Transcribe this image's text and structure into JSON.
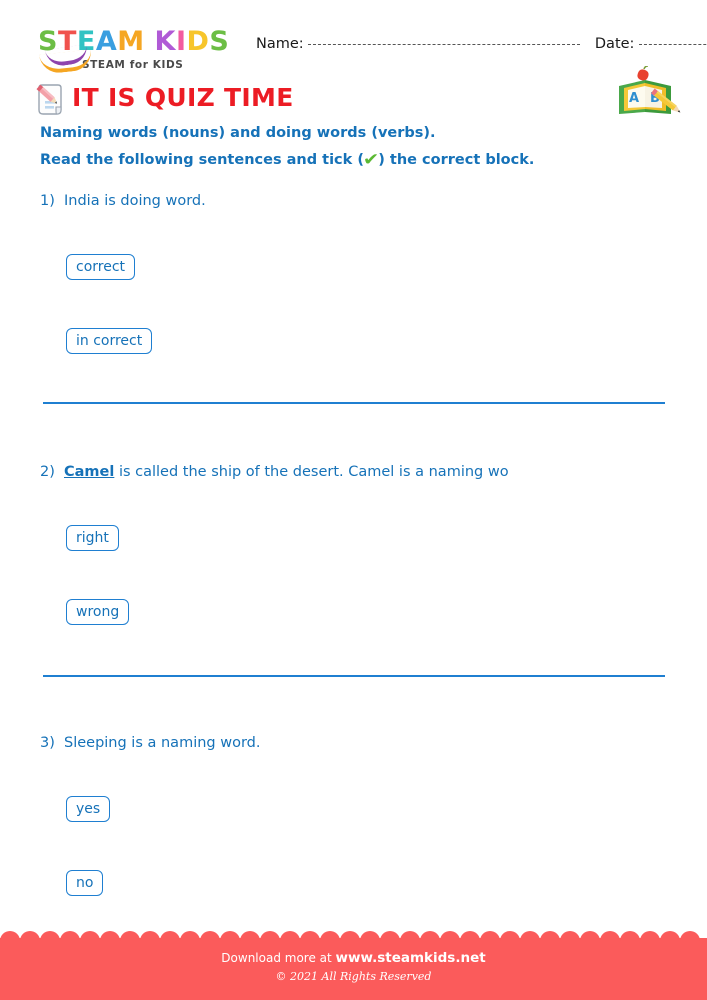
{
  "brand": {
    "logo_letters": [
      {
        "char": "S",
        "color": "#6cbe45"
      },
      {
        "char": "T",
        "color": "#f0524d"
      },
      {
        "char": "E",
        "color": "#31c3c3"
      },
      {
        "char": "A",
        "color": "#3a9fe0"
      },
      {
        "char": "M",
        "color": "#f5a623"
      },
      {
        "char": " ",
        "color": "#ffffff"
      },
      {
        "char": "K",
        "color": "#b05ad6"
      },
      {
        "char": "I",
        "color": "#f25ba0"
      },
      {
        "char": "D",
        "color": "#f7c52b"
      },
      {
        "char": "S",
        "color": "#6cbe45"
      }
    ],
    "tagline": "STEAM for KIDS",
    "swoosh_color_1": "#f5a623",
    "swoosh_color_2": "#8e44ad"
  },
  "header": {
    "name_label": "Name:",
    "date_label": "Date:"
  },
  "title": {
    "text": "IT IS QUIZ TIME",
    "color": "#ec1c24",
    "icon": "quiz-pencil-paper-icon"
  },
  "decor": {
    "abc_book_icon": "abc-book-icon",
    "abc_letters": [
      "A",
      "B"
    ]
  },
  "instructions": {
    "line1": "Naming words (nouns) and doing words (verbs).",
    "line2_before": "Read the following sentences and tick (",
    "tick_glyph": "✔",
    "line2_after": ") the correct block.",
    "color": "#1672b8",
    "tick_color": "#5bb933"
  },
  "questions": [
    {
      "number": "1)",
      "text_plain": "India is doing word.",
      "emphasis": "",
      "text_after": "",
      "options": [
        "correct",
        "in correct"
      ]
    },
    {
      "number": "2)",
      "text_plain": "",
      "emphasis": "Camel",
      "text_after": " is called the ship of the desert. Camel is a naming wo",
      "options": [
        "right",
        "wrong"
      ]
    },
    {
      "number": "3)",
      "text_plain": "Sleeping is a naming word.",
      "emphasis": "",
      "text_after": "",
      "options": [
        "yes",
        "no"
      ]
    }
  ],
  "footer": {
    "download_prefix": "Download more at ",
    "website": "www.steamkids.net",
    "copyright": "© 2021 All Rights Reserved",
    "background": "#fb5b5b"
  }
}
